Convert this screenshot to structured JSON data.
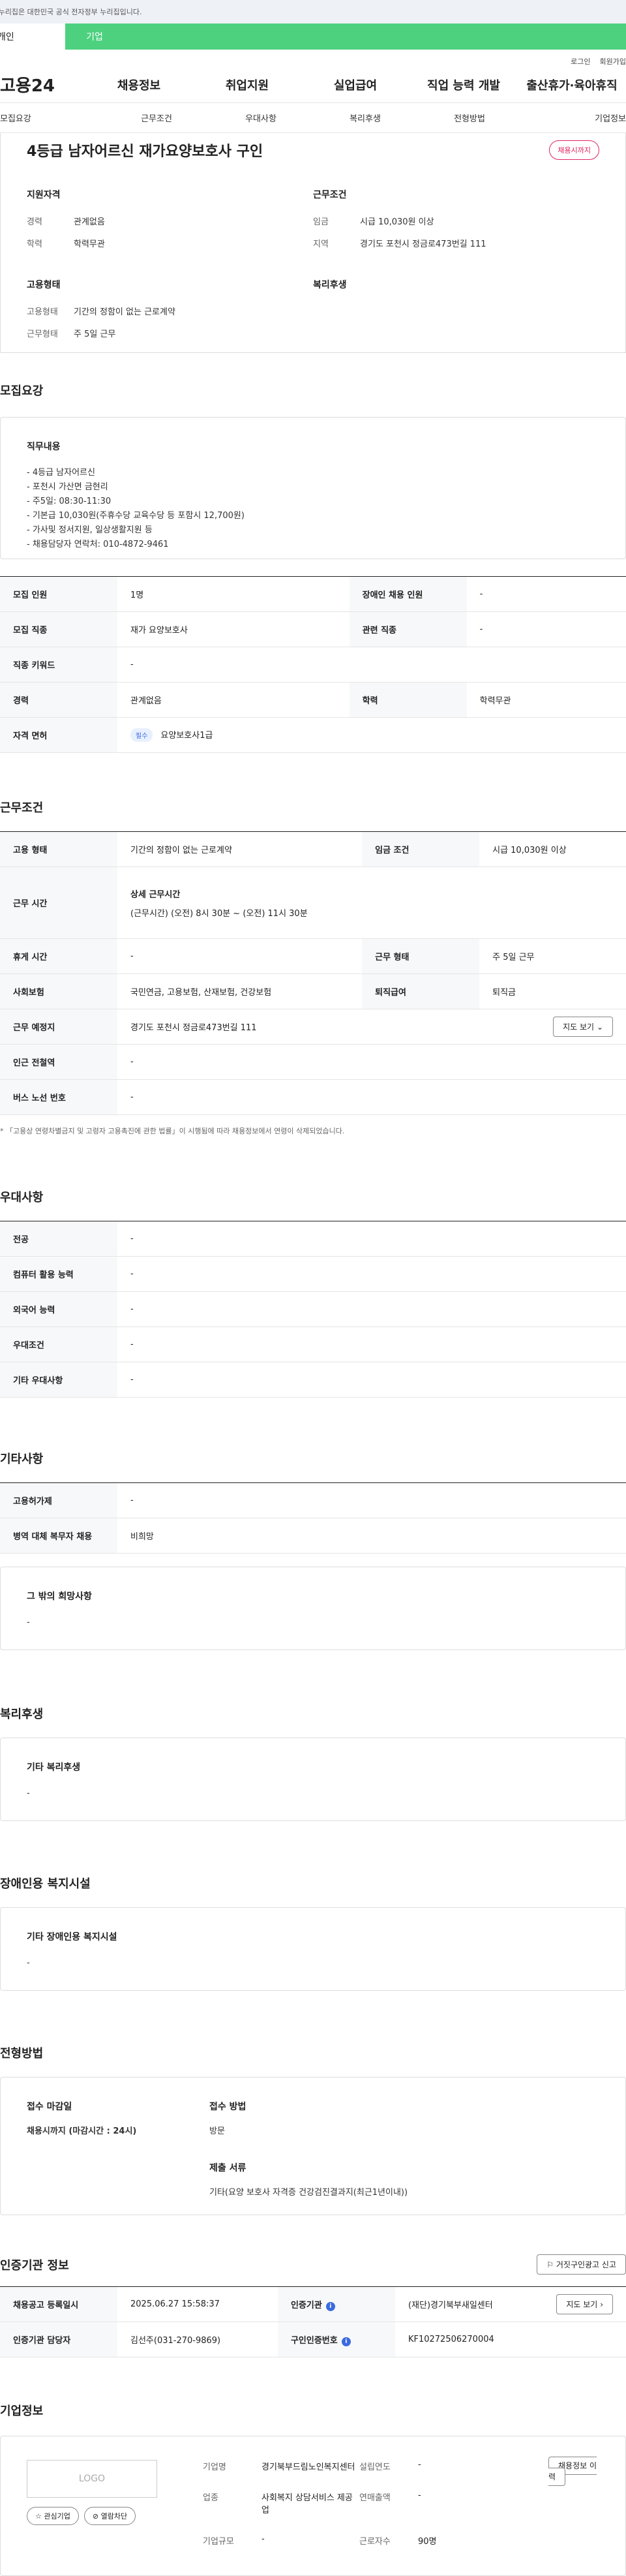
{
  "gov_banner": "이 누리집은 대한민국 공식 전자정부 누리집입니다.",
  "tabs": {
    "personal": "개인",
    "company": "기업"
  },
  "util": {
    "login": "로그인",
    "join": "회원가입"
  },
  "gnb": {
    "logo": "고용24",
    "items": [
      "채용정보",
      "취업지원",
      "실업급여",
      "직업 능력 개발",
      "출산휴가·육아휴직"
    ]
  },
  "snb": [
    "모집요강",
    "근무조건",
    "우대사항",
    "복리후생",
    "전형방법",
    "기업정보"
  ],
  "summary": {
    "title": "4등급 남자어르신 재가요양보호사 구인",
    "badge": "채용시까지",
    "qual_title": "지원자격",
    "career_k": "경력",
    "career_v": "관계없음",
    "edu_k": "학력",
    "edu_v": "학력무관",
    "cond_title": "근무조건",
    "wage_k": "임금",
    "wage_v": "시급 10,030원 이상",
    "area_k": "지역",
    "area_v": "경기도 포천시 정금로473번길 111",
    "emp_title": "고용형태",
    "emptype_k": "고용형태",
    "emptype_v": "기간의 정함이 없는 근로계약",
    "workform_k": "근무형태",
    "workform_v": "주 5일 근무",
    "welfare_title": "복리후생"
  },
  "recruit": {
    "title": "모집요강",
    "duty_title": "직무내용",
    "duty_text": "- 4등급 남자어르신\n- 포천시 가산면 금현리\n- 주5일: 08:30-11:30\n- 기본급 10,030원(주휴수당 교육수당 등 포함시 12,700원)\n- 가사및 정서지원, 일상생활지원 등\n- 채용담당자 연락처: 010-4872-9461",
    "rows": {
      "count_k": "모집 인원",
      "count_v": "1명",
      "disabled_k": "장애인 채용 인원",
      "disabled_v": "-",
      "job_k": "모집 직종",
      "job_v": "재가 요양보호사",
      "related_k": "관련 직종",
      "related_v": "-",
      "keyword_k": "직종 키워드",
      "keyword_v": "-",
      "career_k": "경력",
      "career_v": "관계없음",
      "edu_k": "학력",
      "edu_v": "학력무관",
      "license_k": "자격 면허",
      "license_badge": "필수",
      "license_v": "요양보호사1급"
    }
  },
  "conditions": {
    "title": "근무조건",
    "emptype_k": "고용 형태",
    "emptype_v": "기간의 정함이 없는 근로계약",
    "wage_k": "임금 조건",
    "wage_v": "시급 10,030원 이상",
    "hours_k": "근무 시간",
    "hours_sub": "상세 근무시간",
    "hours_v": "(근무시간) (오전) 8시 30분 ~ (오전) 11시 30분",
    "holiday_k": "휴게 시간",
    "holiday_v": "-",
    "form_k": "근무 형태",
    "form_v": "주 5일 근무",
    "insurance_k": "사회보험",
    "insurance_v": "국민연금, 고용보험, 산재보험, 건강보험",
    "retire_k": "퇴직급여",
    "retire_v": "퇴직금",
    "place_k": "근무 예정지",
    "place_v": "경기도 포천시 정금로473번길 111",
    "map_btn": "지도 보기",
    "subway_k": "인근 전철역",
    "subway_v": "-",
    "bus_k": "버스 노선 번호",
    "bus_v": "-",
    "note": "* 「고용상 연령차별금지 및 고령자 고용촉진에 관한 법률」이 시행됨에 따라 채용정보에서 연령이 삭제되었습니다."
  },
  "prefer": {
    "title": "우대사항",
    "rows": [
      {
        "k": "전공",
        "v": "-"
      },
      {
        "k": "컴퓨터 활용 능력",
        "v": "-"
      },
      {
        "k": "외국어 능력",
        "v": "-"
      },
      {
        "k": "우대조건",
        "v": "-"
      },
      {
        "k": "기타 우대사항",
        "v": "-"
      }
    ]
  },
  "etc": {
    "title": "기타사항",
    "rows": [
      {
        "k": "고용허가제",
        "v": "-"
      },
      {
        "k": "병역 대체 복무자 채용",
        "v": "비희망"
      }
    ],
    "hope_title": "그 밖의 희망사항",
    "hope_v": "-"
  },
  "welfare": {
    "title": "복리후생",
    "box_title": "기타 복리후생",
    "box_v": "-"
  },
  "disability": {
    "title": "장애인용 복지시설",
    "box_title": "기타 장애인용 복지시설",
    "box_v": "-"
  },
  "method": {
    "title": "전형방법",
    "deadline_title": "접수 마감일",
    "deadline_v": "채용시까지 (마감시간 : 24시)",
    "receive_title": "접수 방법",
    "receive_v": "방문",
    "docs_title": "제출 서류",
    "docs_v": "기타(요양 보호사 자격증 건강검진결과지(최근1년이내))"
  },
  "cert": {
    "title": "인증기관 정보",
    "report_btn": "거짓구인광고 신고",
    "reg_k": "채용공고 등록일시",
    "reg_v": "2025.06.27 15:58:37",
    "agency_k": "인증기관",
    "agency_v": "(재단)경기북부새일센터",
    "agency_btn": "지도 보기",
    "manager_k": "인증기관 담당자",
    "manager_v": "김선주(031-270-9869)",
    "num_k": "구인인증번호",
    "num_v": "KF10272506270004"
  },
  "company": {
    "title": "기업정보",
    "logo": "LOGO",
    "fav_btn": "관심기업",
    "block_btn": "열람차단",
    "name_k": "기업명",
    "name_v": "경기북부드림노인복지센터",
    "industry_k": "업종",
    "industry_v": "사회복지 상담서비스 제공업",
    "size_k": "기업규모",
    "size_v": "-",
    "founded_k": "설립연도",
    "founded_v": "-",
    "sales_k": "연매출액",
    "sales_v": "-",
    "employees_k": "근로자수",
    "employees_v": "90명",
    "history_btn": "채용정보 이력"
  }
}
